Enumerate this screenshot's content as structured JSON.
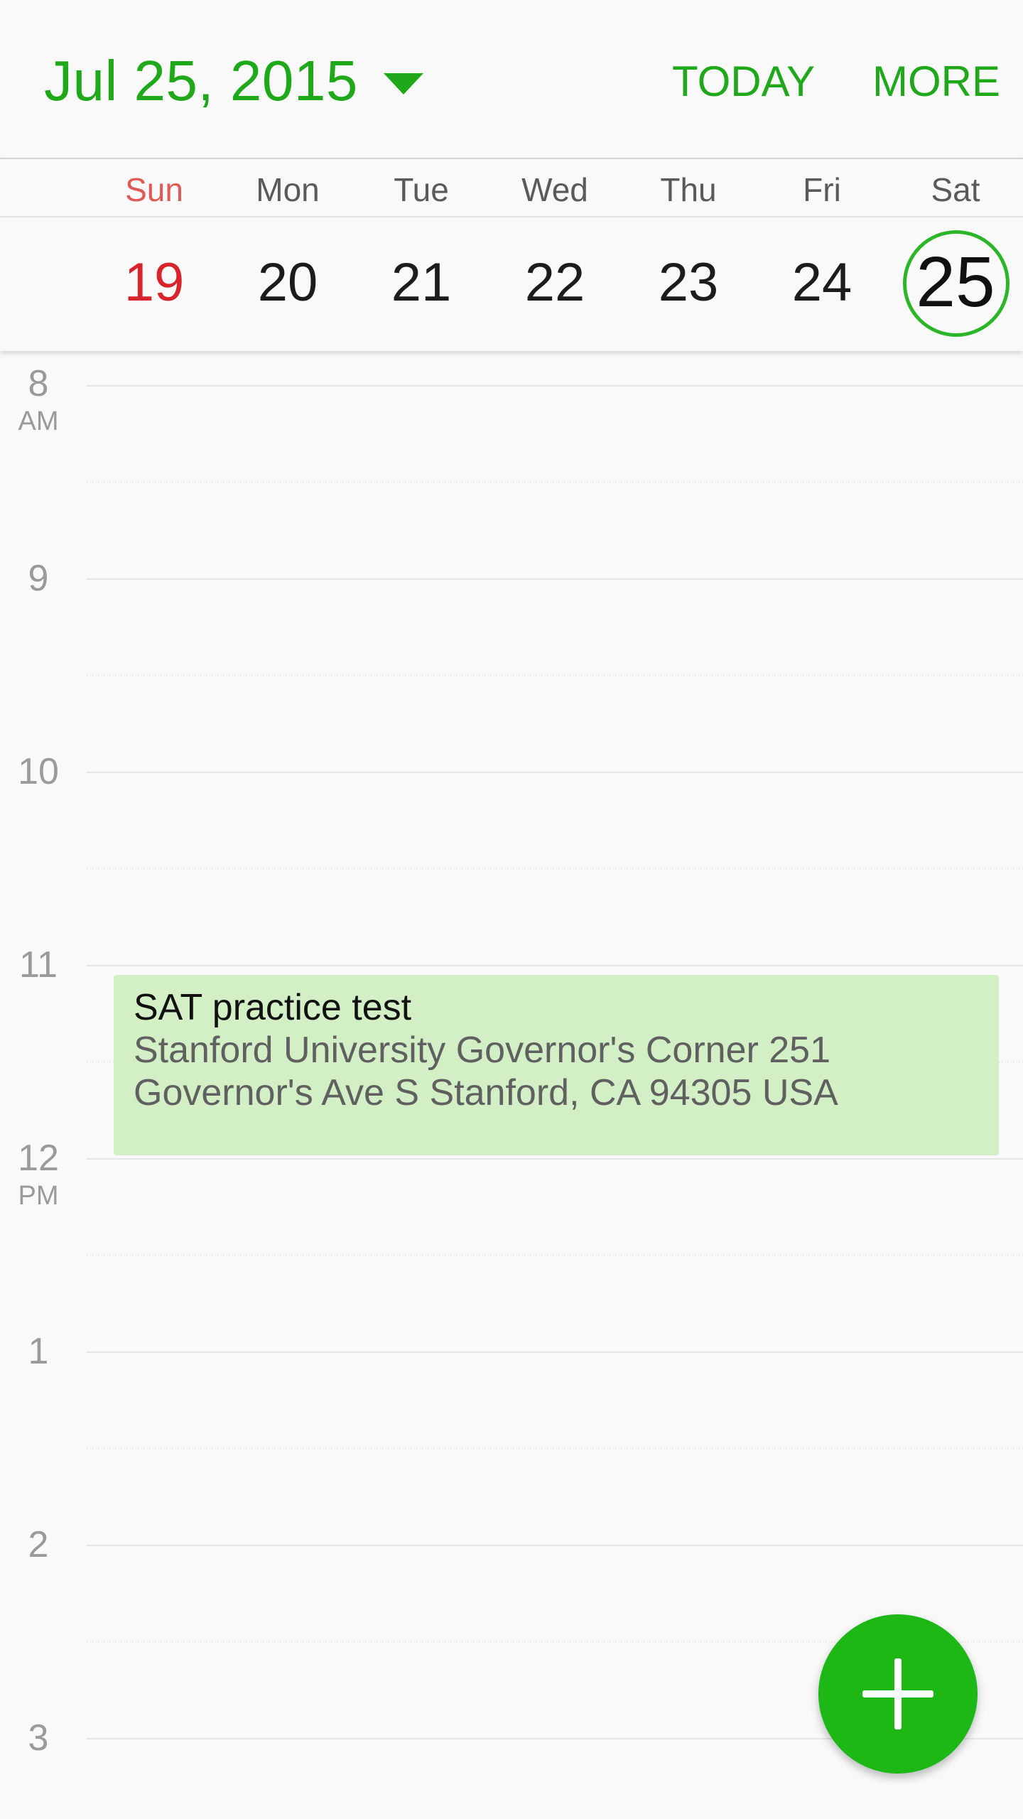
{
  "header": {
    "date_title": "Jul 25, 2015",
    "today_label": "TODAY",
    "more_label": "MORE"
  },
  "week": {
    "days": [
      {
        "name": "Sun",
        "num": "19"
      },
      {
        "name": "Mon",
        "num": "20"
      },
      {
        "name": "Tue",
        "num": "21"
      },
      {
        "name": "Wed",
        "num": "22"
      },
      {
        "name": "Thu",
        "num": "23"
      },
      {
        "name": "Fri",
        "num": "24"
      },
      {
        "name": "Sat",
        "num": "25"
      }
    ],
    "selected_day": "25"
  },
  "timeline": {
    "hours": [
      {
        "label": "8",
        "ampm": "AM"
      },
      {
        "label": "9",
        "ampm": ""
      },
      {
        "label": "10",
        "ampm": ""
      },
      {
        "label": "11",
        "ampm": ""
      },
      {
        "label": "12",
        "ampm": "PM"
      },
      {
        "label": "1",
        "ampm": ""
      },
      {
        "label": "2",
        "ampm": ""
      },
      {
        "label": "3",
        "ampm": ""
      }
    ]
  },
  "event": {
    "title": "SAT practice test",
    "location_line1": "Stanford University Governor's Corner 251",
    "location_line2": "Governor's Ave S Stanford, CA 94305 USA",
    "start": "11 AM",
    "end": "12 PM"
  },
  "fab": {
    "icon": "plus-icon"
  },
  "colors": {
    "accent": "#1fa81a",
    "sunday": "#d8242c",
    "event_bg": "#d3efc5",
    "fab": "#1eb816"
  }
}
